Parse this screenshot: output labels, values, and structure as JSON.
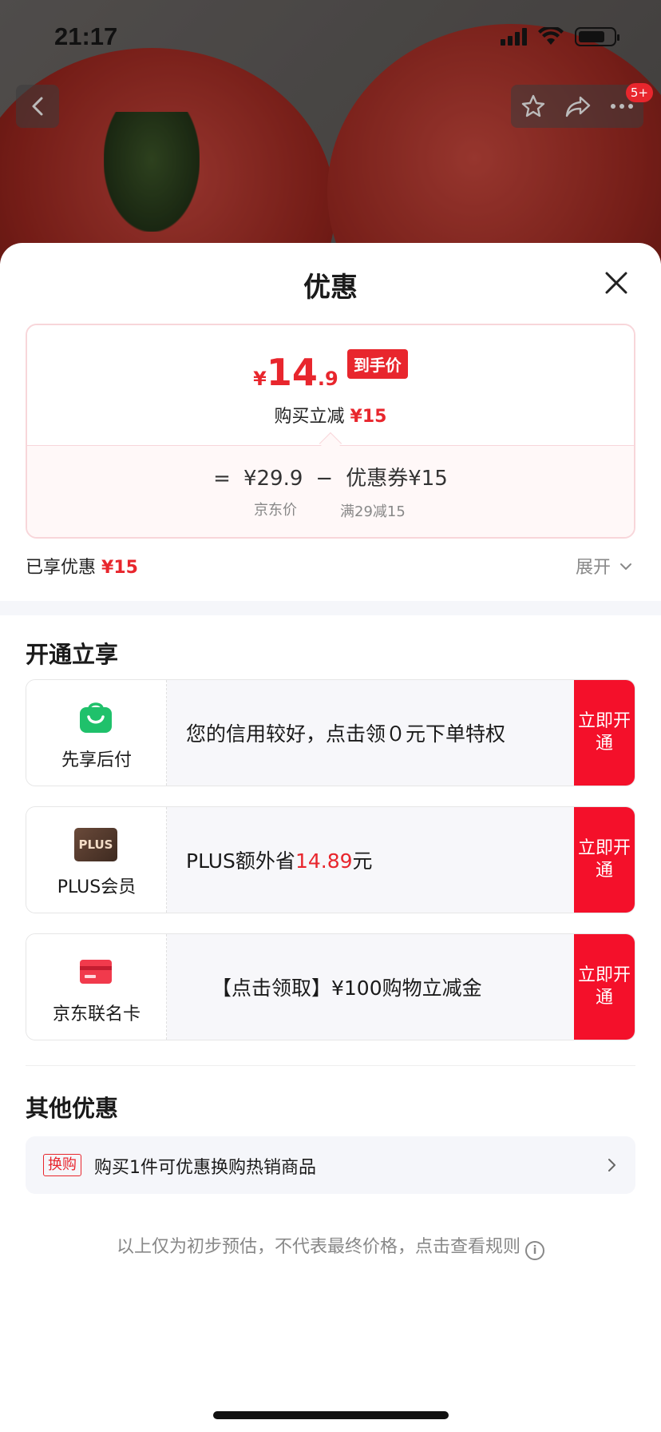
{
  "status_bar": {
    "time": "21:17"
  },
  "nav": {
    "badge": "5+"
  },
  "sheet": {
    "title": "优惠",
    "price": {
      "currency": "¥",
      "integer": "14",
      "decimal": ".9",
      "tag": "到手价",
      "sub_prefix": "购买立减",
      "sub_amount": "¥15"
    },
    "formula": {
      "equals": "=",
      "jd_price": "¥29.9",
      "minus": "−",
      "coupon": "优惠券¥15",
      "jd_price_label": "京东价",
      "coupon_label": "满29减15"
    },
    "enjoyed_label": "已享优惠",
    "enjoyed_amount": "¥15",
    "expand_label": "展开"
  },
  "open_section": {
    "title": "开通立享",
    "offers": [
      {
        "name": "先享后付",
        "text": "您的信用较好，点击领０元下单特权",
        "button": "立即开通"
      },
      {
        "name": "PLUS会员",
        "text_prefix": "PLUS额外省",
        "text_amount": "14.89",
        "text_suffix": "元",
        "icon_text": "PLUS",
        "button": "立即开通"
      },
      {
        "name": "京东联名卡",
        "text": "【点击领取】¥100购物立减金",
        "button": "立即开通"
      }
    ]
  },
  "other_section": {
    "title": "其他优惠",
    "tag": "换购",
    "text": "购买1件可优惠换购热销商品"
  },
  "disclaimer": "以上仅为初步预估，不代表最终价格，点击查看规则",
  "colors": {
    "accent": "#e8262d",
    "button_red": "#f4102a",
    "success_green": "#1fc16b"
  }
}
